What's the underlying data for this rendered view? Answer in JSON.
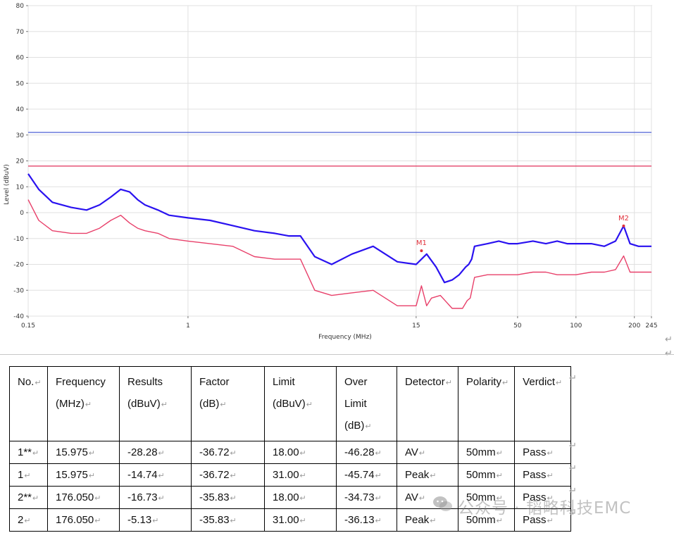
{
  "chart_data": {
    "type": "line",
    "xscale": "log",
    "xlim": [
      0.15,
      245
    ],
    "ylim": [
      -40,
      80
    ],
    "xlabel": "Frequency (MHz)",
    "ylabel": "Level (dBuV)",
    "x_ticks": [
      0.15,
      1,
      15,
      50,
      100,
      200,
      245
    ],
    "x_tick_labels": [
      "0.15",
      "1",
      "15",
      "50",
      "100",
      "200",
      "245"
    ],
    "y_ticks": [
      80,
      70,
      60,
      50,
      40,
      30,
      20,
      10,
      0,
      -10,
      -20,
      -30,
      -40
    ],
    "grid": true,
    "limit_lines": [
      {
        "detector": "Peak",
        "value": 31,
        "color": "#3a4fd0"
      },
      {
        "detector": "AV",
        "value": 18,
        "color": "#e0305a"
      }
    ],
    "series": [
      {
        "detector": "Peak",
        "color": "#2a12f0",
        "x": [
          0.15,
          0.17,
          0.2,
          0.25,
          0.3,
          0.35,
          0.4,
          0.45,
          0.5,
          0.55,
          0.6,
          0.7,
          0.8,
          1.0,
          1.3,
          1.7,
          2.2,
          2.8,
          3.3,
          3.8,
          4.5,
          5.5,
          7.0,
          9.0,
          12.0,
          15.0,
          17.0,
          19.0,
          21.0,
          23.0,
          25.0,
          27.0,
          28.0,
          29.0,
          30.0,
          35.0,
          40.0,
          45.0,
          50.0,
          60.0,
          70.0,
          80.0,
          90.0,
          100.0,
          120.0,
          140.0,
          160.0,
          176.05,
          190.0,
          210.0,
          230.0,
          245.0
        ],
        "y": [
          15,
          9,
          4,
          2,
          1,
          3,
          6,
          9,
          8,
          5,
          3,
          1,
          -1,
          -2,
          -3,
          -5,
          -7,
          -8,
          -9,
          -9,
          -17,
          -20,
          -16,
          -13,
          -19,
          -20,
          -16,
          -21,
          -27,
          -26,
          -24,
          -21,
          -20,
          -18,
          -13,
          -12,
          -11,
          -12,
          -12,
          -11,
          -12,
          -11,
          -12,
          -12,
          -12,
          -13,
          -11,
          -5.13,
          -12,
          -13,
          -13,
          -13
        ]
      },
      {
        "detector": "AV",
        "color": "#e8406a",
        "x": [
          0.15,
          0.17,
          0.2,
          0.25,
          0.3,
          0.35,
          0.4,
          0.45,
          0.5,
          0.55,
          0.6,
          0.7,
          0.8,
          1.0,
          1.3,
          1.7,
          2.2,
          2.8,
          3.3,
          3.8,
          4.5,
          5.5,
          7.0,
          9.0,
          12.0,
          15.0,
          15.975,
          17.0,
          18.0,
          20.0,
          23.0,
          26.0,
          27.5,
          28.5,
          30.0,
          35.0,
          40.0,
          45.0,
          50.0,
          60.0,
          70.0,
          80.0,
          90.0,
          100.0,
          120.0,
          140.0,
          160.0,
          176.05,
          190.0,
          210.0,
          230.0,
          245.0
        ],
        "y": [
          5,
          -3,
          -7,
          -8,
          -8,
          -6,
          -3,
          -1,
          -4,
          -6,
          -7,
          -8,
          -10,
          -11,
          -12,
          -13,
          -17,
          -18,
          -18,
          -18,
          -30,
          -32,
          -31,
          -30,
          -36,
          -36,
          -28.28,
          -36,
          -33,
          -32,
          -37,
          -37,
          -34,
          -33,
          -25,
          -24,
          -24,
          -24,
          -24,
          -23,
          -23,
          -24,
          -24,
          -24,
          -23,
          -23,
          -22,
          -16.73,
          -23,
          -23,
          -23,
          -23
        ]
      }
    ],
    "markers": [
      {
        "label": "M1",
        "x": 15.975,
        "y": -14.74
      },
      {
        "label": "M2",
        "x": 176.05,
        "y": -5.13
      }
    ]
  },
  "table": {
    "headers": [
      [
        "No."
      ],
      [
        "Frequency",
        "(MHz)"
      ],
      [
        "Results",
        "(dBuV)"
      ],
      [
        "Factor (dB)"
      ],
      [
        "Limit",
        "(dBuV)"
      ],
      [
        "Over",
        "Limit",
        "(dB)"
      ],
      [
        "Detector"
      ],
      [
        "Polarity"
      ],
      [
        "Verdict"
      ]
    ],
    "rows": [
      [
        "1**",
        "15.975",
        "-28.28",
        "-36.72",
        "18.00",
        "-46.28",
        "AV",
        "50mm",
        "Pass"
      ],
      [
        "1",
        "15.975",
        "-14.74",
        "-36.72",
        "31.00",
        "-45.74",
        "Peak",
        "50mm",
        "Pass"
      ],
      [
        "2**",
        "176.050",
        "-16.73",
        "-35.83",
        "18.00",
        "-34.73",
        "AV",
        "50mm",
        "Pass"
      ],
      [
        "2",
        "176.050",
        "-5.13",
        "-35.83",
        "31.00",
        "-36.13",
        "Peak",
        "50mm",
        "Pass"
      ]
    ]
  },
  "watermark": {
    "icon": "wechat-icon",
    "text": "公众号 · 韬略科技EMC"
  }
}
